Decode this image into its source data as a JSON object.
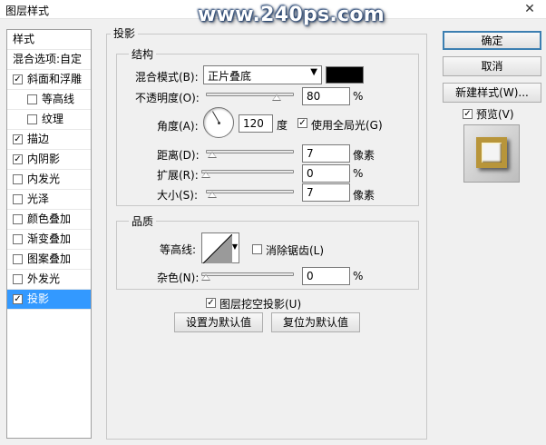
{
  "window": {
    "title": "图层样式",
    "watermark": "www.240ps.com"
  },
  "style_list": {
    "header": "样式",
    "blend_options": "混合选项:自定",
    "items": [
      {
        "label": "斜面和浮雕",
        "checked": true,
        "indent": false
      },
      {
        "label": "等高线",
        "checked": false,
        "indent": true
      },
      {
        "label": "纹理",
        "checked": false,
        "indent": true
      },
      {
        "label": "描边",
        "checked": true,
        "indent": false
      },
      {
        "label": "内阴影",
        "checked": true,
        "indent": false
      },
      {
        "label": "内发光",
        "checked": false,
        "indent": false
      },
      {
        "label": "光泽",
        "checked": false,
        "indent": false
      },
      {
        "label": "颜色叠加",
        "checked": false,
        "indent": false
      },
      {
        "label": "渐变叠加",
        "checked": false,
        "indent": false
      },
      {
        "label": "图案叠加",
        "checked": false,
        "indent": false
      },
      {
        "label": "外发光",
        "checked": false,
        "indent": false
      },
      {
        "label": "投影",
        "checked": true,
        "indent": false,
        "selected": true
      }
    ]
  },
  "drop_shadow": {
    "section_title": "投影",
    "structure": {
      "title": "结构",
      "blend_mode_label": "混合模式(B):",
      "blend_mode_value": "正片叠底",
      "shadow_color": "#000000",
      "opacity_label": "不透明度(O):",
      "opacity_value": "80",
      "opacity_unit": "%",
      "opacity_level": 0.8,
      "angle_label": "角度(A):",
      "angle_value": "120",
      "angle_unit": "度",
      "use_global_light_label": "使用全局光(G)",
      "use_global_light_checked": true,
      "distance_label": "距离(D):",
      "distance_value": "7",
      "distance_unit": "像素",
      "spread_label": "扩展(R):",
      "spread_value": "0",
      "spread_unit": "%",
      "size_label": "大小(S):",
      "size_value": "7",
      "size_unit": "像素"
    },
    "quality": {
      "title": "品质",
      "contour_label": "等高线:",
      "antialias_label": "消除锯齿(L)",
      "antialias_checked": false,
      "noise_label": "杂色(N):",
      "noise_value": "0",
      "noise_unit": "%"
    },
    "knockout_label": "图层挖空投影(U)",
    "knockout_checked": true,
    "make_default": "设置为默认值",
    "reset_default": "复位为默认值"
  },
  "buttons": {
    "ok": "确定",
    "cancel": "取消",
    "new_style": "新建样式(W)...",
    "preview_label": "预览(V)",
    "preview_checked": true
  }
}
